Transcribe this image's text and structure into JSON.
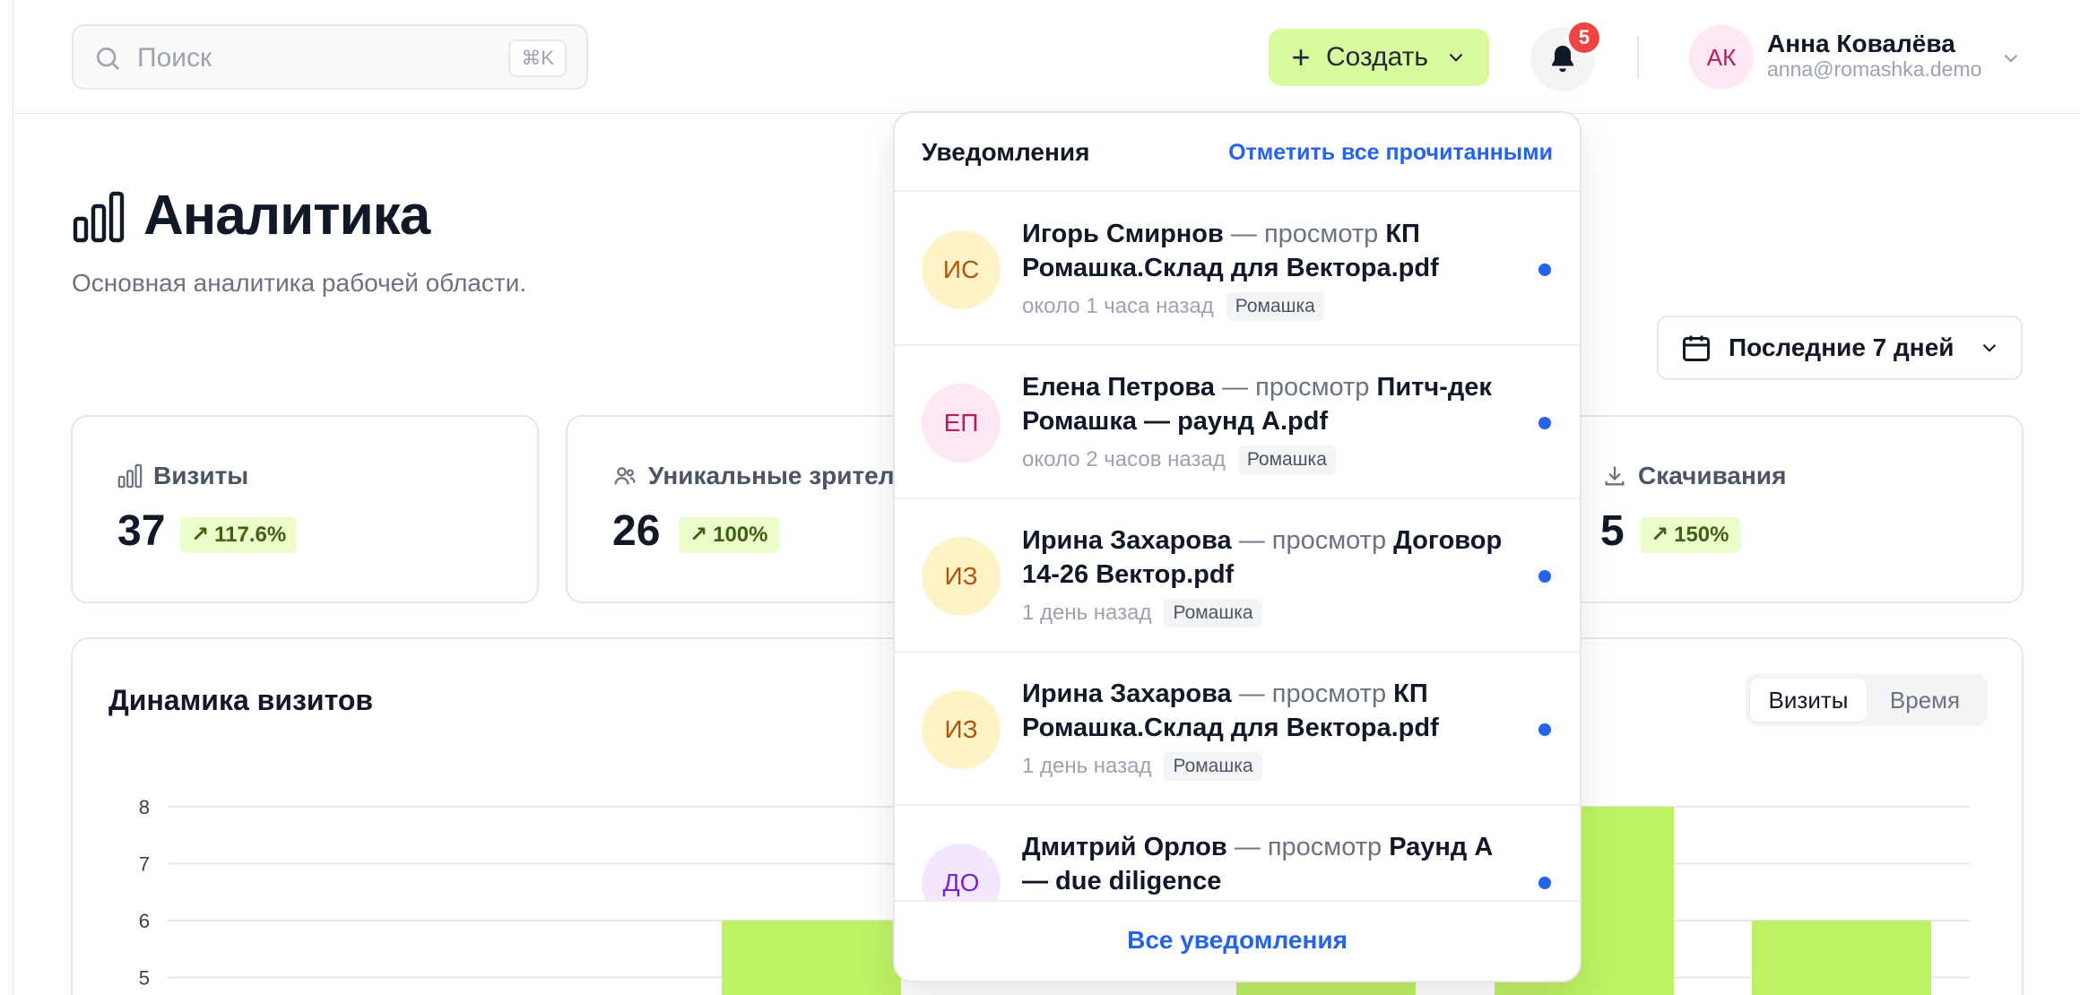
{
  "search": {
    "placeholder": "Поиск",
    "shortcut": "⌘K"
  },
  "header": {
    "create_label": "Создать",
    "notification_count": "5",
    "user": {
      "initials": "АК",
      "name": "Анна Ковалёва",
      "email": "anna@romashka.demo"
    }
  },
  "page": {
    "title": "Аналитика",
    "subtitle": "Основная аналитика рабочей области.",
    "date_range": "Последние 7 дней"
  },
  "stats": [
    {
      "label": "Визиты",
      "value": "37",
      "delta": "117.6%"
    },
    {
      "label": "Уникальные зрители",
      "value": "26",
      "delta": "100%"
    },
    {
      "label": "Скачивания",
      "value": "5",
      "delta": "150%"
    }
  ],
  "chart": {
    "title": "Динамика визитов",
    "toggle": [
      "Визиты",
      "Время"
    ],
    "active_toggle": "Визиты"
  },
  "chart_data": {
    "type": "bar",
    "title": "Динамика визитов",
    "y_ticks": [
      "8",
      "7",
      "6",
      "5"
    ],
    "ylim_visible": [
      4.7,
      8
    ],
    "series": [
      {
        "values": [
          6,
          6,
          8,
          6
        ]
      }
    ]
  },
  "notifications": {
    "title": "Уведомления",
    "mark_all": "Отметить все прочитанными",
    "all_link": "Все уведомления",
    "items": [
      {
        "initials": "ИС",
        "name": "Игорь Смирнов",
        "action": " — просмотр ",
        "doc": "КП Ромашка.Склад для Вектора.pdf",
        "time": "около 1 часа назад",
        "tag": "Ромашка",
        "bg": "#fef3c7",
        "fg": "#b45309"
      },
      {
        "initials": "ЕП",
        "name": "Елена Петрова",
        "action": " — просмотр ",
        "doc": "Питч-дек Ромашка — раунд A.pdf",
        "time": "около 2 часов назад",
        "tag": "Ромашка",
        "bg": "#fce7f3",
        "fg": "#be185d"
      },
      {
        "initials": "ИЗ",
        "name": "Ирина Захарова",
        "action": " — просмотр ",
        "doc": "Договор 14-26 Вектор.pdf",
        "time": "1 день назад",
        "tag": "Ромашка",
        "bg": "#fef3c7",
        "fg": "#b45309"
      },
      {
        "initials": "ИЗ",
        "name": "Ирина Захарова",
        "action": " — просмотр ",
        "doc": "КП Ромашка.Склад для Вектора.pdf",
        "time": "1 день назад",
        "tag": "Ромашка",
        "bg": "#fef3c7",
        "fg": "#b45309"
      },
      {
        "initials": "ДО",
        "name": "Дмитрий Орлов",
        "action": " — просмотр ",
        "doc": "Раунд A — due diligence",
        "time": "",
        "tag": "",
        "bg": "#f3e8ff",
        "fg": "#7e22ce"
      }
    ]
  },
  "colors": {
    "accent": "#d9f99d",
    "bar": "#bef264",
    "link": "#2563eb",
    "badge": "#ef4444"
  }
}
